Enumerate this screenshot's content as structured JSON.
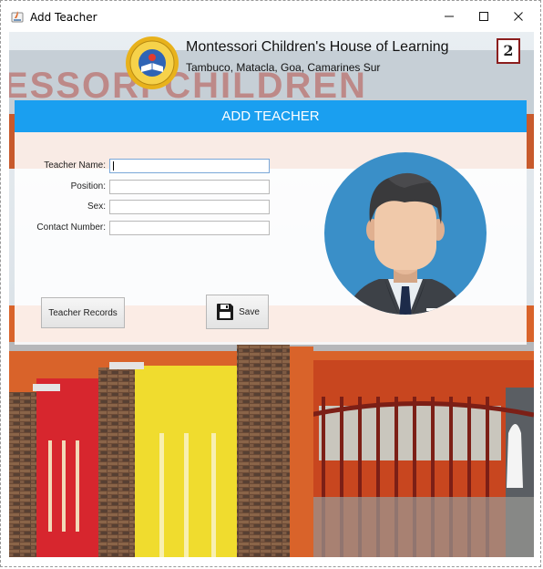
{
  "window": {
    "title": "Add Teacher"
  },
  "header": {
    "school_name": "Montessori Children's House of Learning",
    "address": "Tambuco, Matacla, Goa, Camarines Sur",
    "page_number": "2",
    "banner_text": "ESSORI CHILDREN"
  },
  "form": {
    "title": "ADD TEACHER",
    "fields": [
      {
        "label": "Teacher Name:",
        "value": ""
      },
      {
        "label": "Position:",
        "value": ""
      },
      {
        "label": "Sex:",
        "value": ""
      },
      {
        "label": "Contact Number:",
        "value": ""
      }
    ],
    "records_button": "Teacher Records",
    "save_button": "Save"
  },
  "colors": {
    "header_blue": "#1a9ff0",
    "avatar_circle": "#3a8fc8",
    "wall_yellow": "#f0dc2e",
    "wall_red": "#d7262e",
    "building_orange": "#d95a1c"
  }
}
